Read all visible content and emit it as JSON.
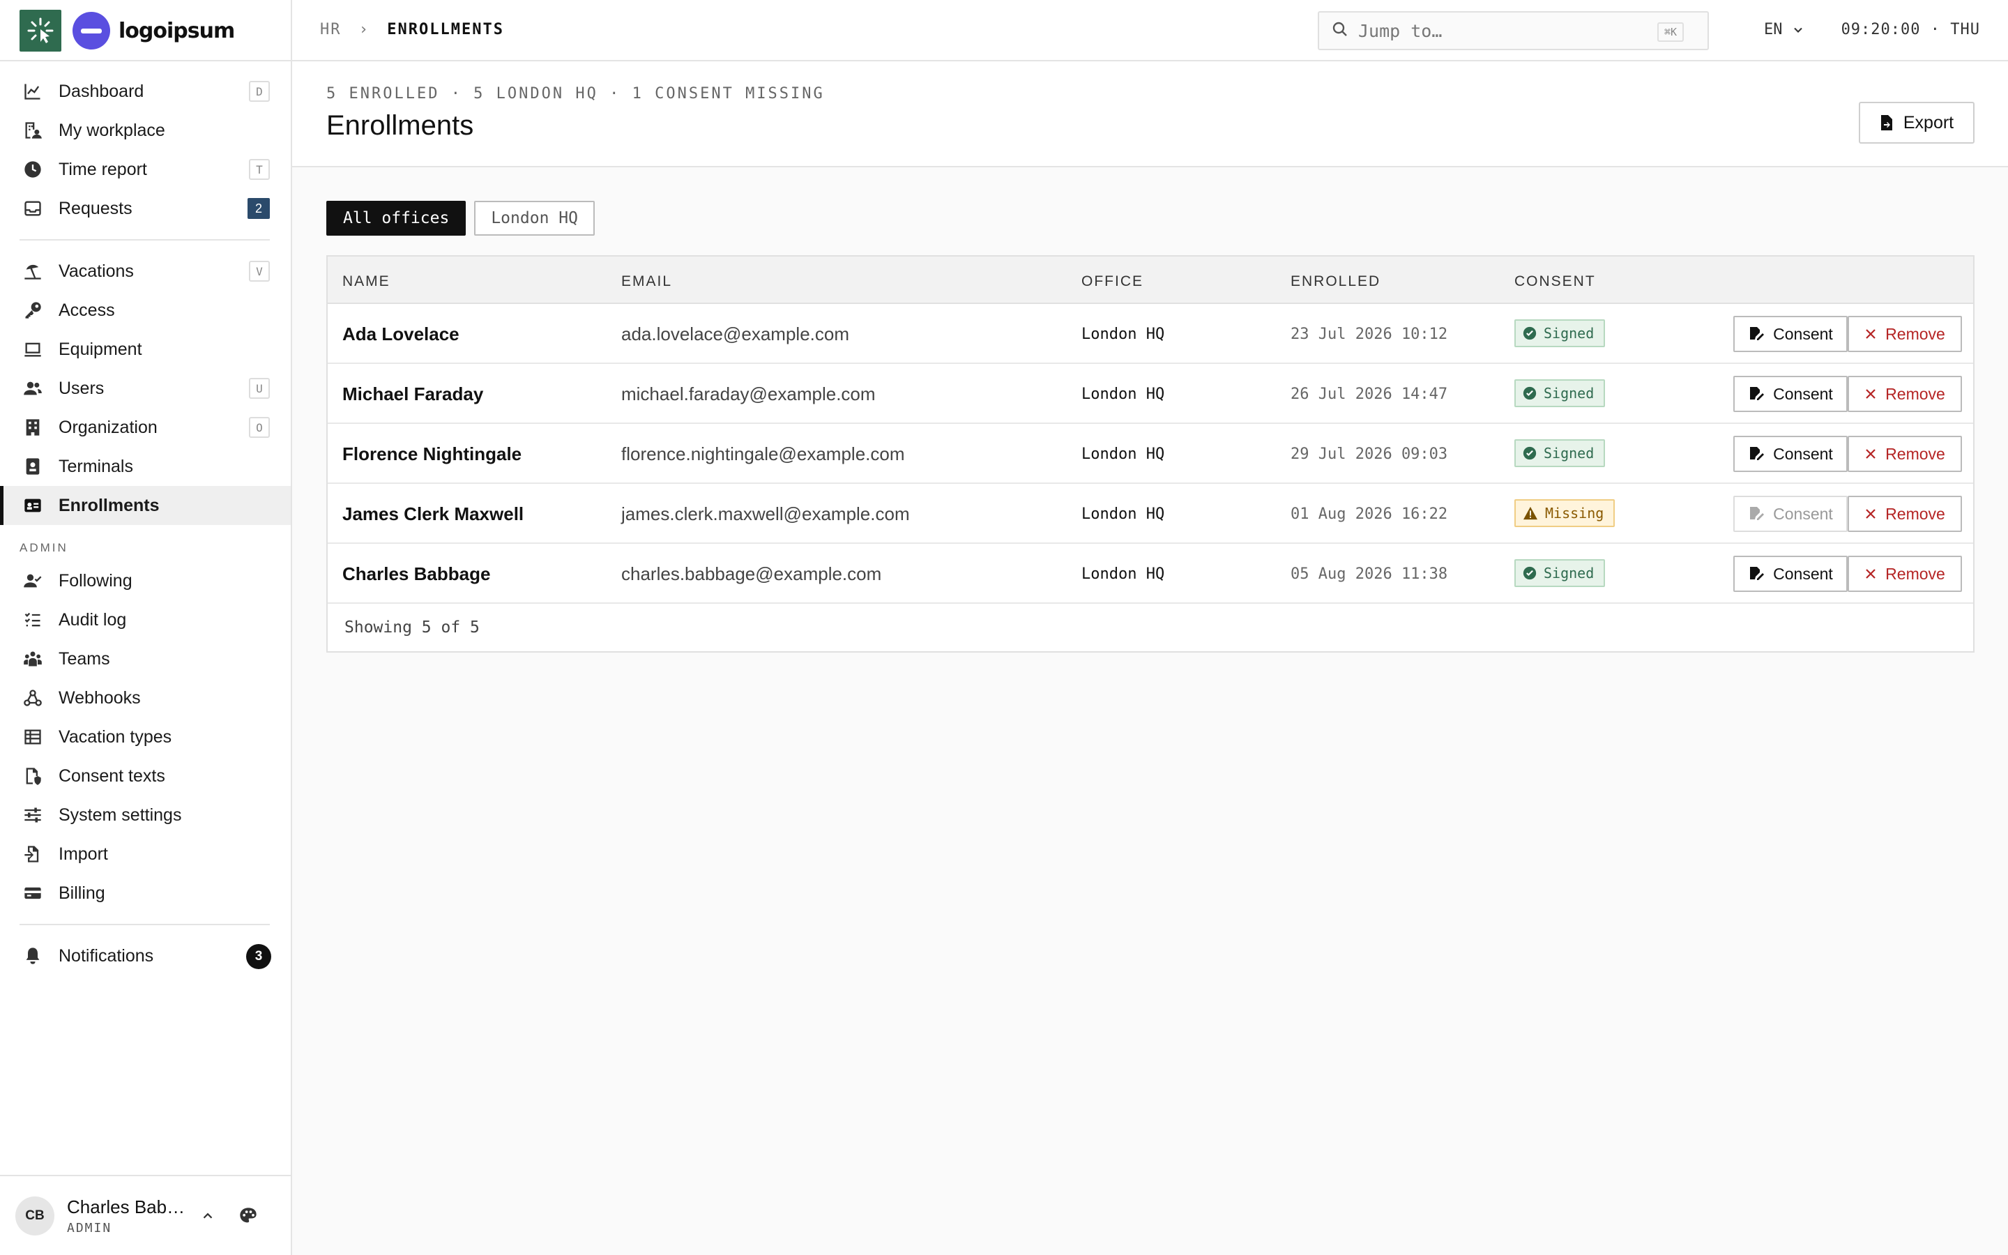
{
  "brand": {
    "name": "logoipsum"
  },
  "sidebar": {
    "items": [
      {
        "label": "Dashboard",
        "kbd": "D"
      },
      {
        "label": "My workplace"
      },
      {
        "label": "Time report",
        "kbd": "T"
      },
      {
        "label": "Requests",
        "count": "2"
      },
      {
        "label": "Vacations",
        "kbd": "V"
      },
      {
        "label": "Access"
      },
      {
        "label": "Equipment"
      },
      {
        "label": "Users",
        "kbd": "U"
      },
      {
        "label": "Organization",
        "kbd": "O"
      },
      {
        "label": "Terminals"
      },
      {
        "label": "Enrollments"
      }
    ],
    "admin_label": "ADMIN",
    "admin_items": [
      {
        "label": "Following"
      },
      {
        "label": "Audit log"
      },
      {
        "label": "Teams"
      },
      {
        "label": "Webhooks"
      },
      {
        "label": "Vacation types"
      },
      {
        "label": "Consent texts"
      },
      {
        "label": "System settings"
      },
      {
        "label": "Import"
      },
      {
        "label": "Billing"
      }
    ],
    "notifications": {
      "label": "Notifications",
      "count": "3"
    },
    "user": {
      "initials": "CB",
      "name": "Charles Babbage",
      "role": "ADMIN"
    }
  },
  "header": {
    "breadcrumb": {
      "parent": "HR",
      "sep": "›",
      "current": "ENROLLMENTS"
    },
    "search": {
      "placeholder": "Jump to…",
      "shortcut": "⌘K"
    },
    "lang": "EN",
    "clock": "09:20:00 · THU"
  },
  "page": {
    "summary": "5 ENROLLED · 5 LONDON HQ · 1 CONSENT MISSING",
    "title": "Enrollments",
    "export_label": "Export"
  },
  "filters": [
    {
      "label": "All offices",
      "active": true
    },
    {
      "label": "London HQ",
      "active": false
    }
  ],
  "table": {
    "columns": [
      "NAME",
      "EMAIL",
      "OFFICE",
      "ENROLLED",
      "CONSENT"
    ],
    "rows": [
      {
        "name": "Ada Lovelace",
        "email": "ada.lovelace@example.com",
        "office": "London HQ",
        "enrolled": "23 Jul 2026 10:12",
        "consent": "Signed"
      },
      {
        "name": "Michael Faraday",
        "email": "michael.faraday@example.com",
        "office": "London HQ",
        "enrolled": "26 Jul 2026 14:47",
        "consent": "Signed"
      },
      {
        "name": "Florence Nightingale",
        "email": "florence.nightingale@example.com",
        "office": "London HQ",
        "enrolled": "29 Jul 2026 09:03",
        "consent": "Signed"
      },
      {
        "name": "James Clerk Maxwell",
        "email": "james.clerk.maxwell@example.com",
        "office": "London HQ",
        "enrolled": "01 Aug 2026 16:22",
        "consent": "Missing"
      },
      {
        "name": "Charles Babbage",
        "email": "charles.babbage@example.com",
        "office": "London HQ",
        "enrolled": "05 Aug 2026 11:38",
        "consent": "Signed"
      }
    ],
    "consent_btn": "Consent",
    "remove_btn": "Remove",
    "footer": "Showing 5 of 5"
  }
}
